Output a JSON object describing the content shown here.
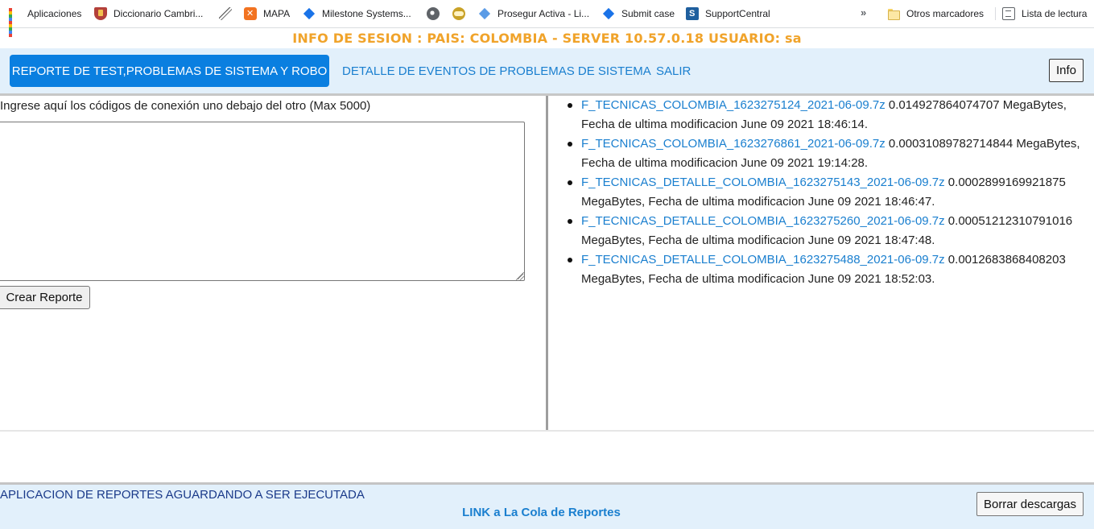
{
  "bookmarks": {
    "items": [
      {
        "label": "Aplicaciones",
        "icon": "apps-grid-icon"
      },
      {
        "label": "Diccionario Cambri...",
        "icon": "cambridge-shield-icon"
      },
      {
        "label": "",
        "icon": "feather-icon"
      },
      {
        "label": "MAPA",
        "icon": "xampp-icon"
      },
      {
        "label": "Milestone Systems...",
        "icon": "milestone-diamond-icon"
      },
      {
        "label": "",
        "icon": "globe-icon"
      },
      {
        "label": "",
        "icon": "cloud-icon"
      },
      {
        "label": "Prosegur Activa - Li...",
        "icon": "prosegur-diamond-icon"
      },
      {
        "label": "Submit case",
        "icon": "submit-diamond-icon"
      },
      {
        "label": "SupportCentral",
        "icon": "supportcentral-icon"
      }
    ],
    "overflow_label": "»",
    "other_bookmarks": "Otros marcadores",
    "reading_list": "Lista de lectura"
  },
  "session": {
    "text": "INFO DE SESION : PAIS: COLOMBIA - SERVER 10.57.0.18 USUARIO: sa"
  },
  "nav": {
    "tab_report": "REPORTE DE TEST,PROBLEMAS DE SISTEMA Y ROBO",
    "tab_detail": "DETALLE DE EVENTOS DE PROBLEMAS DE SISTEMA",
    "tab_exit": "SALIR",
    "info_button": "Info"
  },
  "form": {
    "codes_label": "Ingrese aquí los códigos de conexión uno debajo del otro (Max 5000)",
    "codes_value": "",
    "create_button": "Crear Reporte"
  },
  "files": [
    {
      "name": "F_TECNICAS_COLOMBIA_1623275124_2021-06-09.7z",
      "info": " 0.014927864074707 MegaBytes, Fecha de ultima modificacion June 09 2021 18:46:14."
    },
    {
      "name": "F_TECNICAS_COLOMBIA_1623276861_2021-06-09.7z",
      "info": " 0.00031089782714844 MegaBytes, Fecha de ultima modificacion June 09 2021 19:14:28."
    },
    {
      "name": "F_TECNICAS_DETALLE_COLOMBIA_1623275143_2021-06-09.7z",
      "info": " 0.0002899169921875 MegaBytes, Fecha de ultima modificacion June 09 2021 18:46:47."
    },
    {
      "name": "F_TECNICAS_DETALLE_COLOMBIA_1623275260_2021-06-09.7z",
      "info": " 0.00051212310791016 MegaBytes, Fecha de ultima modificacion June 09 2021 18:47:48."
    },
    {
      "name": "F_TECNICAS_DETALLE_COLOMBIA_1623275488_2021-06-09.7z",
      "info": " 0.0012683868408203 MegaBytes, Fecha de ultima modificacion June 09 2021 18:52:03."
    }
  ],
  "footer": {
    "status_text": "APLICACION DE REPORTES AGUARDANDO A SER EJECUTADA",
    "queue_link": "LINK a La Cola de Reportes",
    "clear_button": "Borrar descargas"
  },
  "colors": {
    "accent": "#0a7fe0",
    "link": "#1a7fcf",
    "session_text": "#f0a32a",
    "nav_background": "#e2f0fb",
    "status_text": "#1a3a8a"
  }
}
